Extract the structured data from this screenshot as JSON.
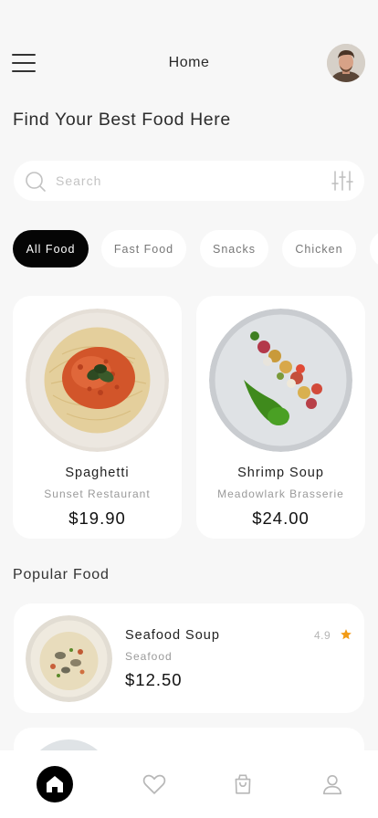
{
  "header": {
    "title": "Home"
  },
  "headline": "Find Your Best Food Here",
  "search": {
    "placeholder": "Search"
  },
  "categories": [
    {
      "label": "All Food",
      "active": true
    },
    {
      "label": "Fast Food",
      "active": false
    },
    {
      "label": "Snacks",
      "active": false
    },
    {
      "label": "Chicken",
      "active": false
    }
  ],
  "featured": [
    {
      "name": "Spaghetti",
      "restaurant": "Sunset Restaurant",
      "price": "$19.90"
    },
    {
      "name": "Shrimp Soup",
      "restaurant": "Meadowlark Brasserie",
      "price": "$24.00"
    }
  ],
  "popular": {
    "title": "Popular Food",
    "items": [
      {
        "name": "Seafood Soup",
        "category": "Seafood",
        "price": "$12.50",
        "rating": "4.9"
      }
    ]
  },
  "bottom_nav": [
    {
      "icon": "home-icon",
      "active": true
    },
    {
      "icon": "heart-icon",
      "active": false
    },
    {
      "icon": "shopping-bag-icon",
      "active": false
    },
    {
      "icon": "user-icon",
      "active": false
    }
  ],
  "colors": {
    "background": "#f7f7f7",
    "active_chip": "#050505",
    "star": "#f29b16"
  }
}
